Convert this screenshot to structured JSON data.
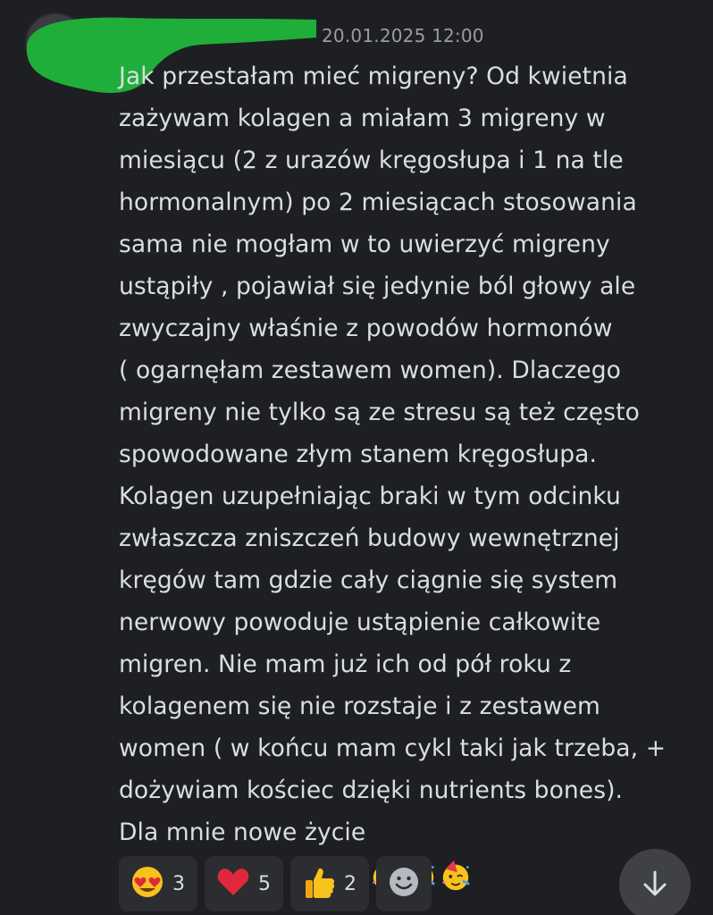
{
  "message": {
    "timestamp": "20.01.2025 12:00",
    "text": "Jak przestałam mieć migreny? Od kwietnia\nzażywam kolagen a miałam 3 migreny w\nmiesiącu (2 z urazów kręgosłupa i 1 na tle\nhormonalnym) po 2 miesiącach stosowania\nsama nie mogłam w to uwierzyć migreny\nustąpiły , pojawiał się jedynie ból głowy ale\nzwyczajny właśnie z powodów hormonów\n( ogarnęłam zestawem women). Dlaczego\nmigreny nie tylko są ze stresu są też często\nspowodowane złym stanem kręgosłupa.\nKolagen uzupełniając braki w tym odcinku\nzwłaszcza zniszczeń budowy wewnętrznej\nkręgów tam gdzie cały ciągnie się system\nnerwowy powoduje ustąpienie całkowite\nmigren. Nie mam już ich od pół roku z\nkolagenem się nie rozstaje i z zestawem\nwomen ( w końcu mam cykl taki jak trzeba, +\ndożywiam kościec dzięki nutrients bones).\nDla mnie nowe życie",
    "trailing_emojis": [
      "partying-face-icon",
      "partying-face-icon",
      "partying-face-icon"
    ]
  },
  "reactions": [
    {
      "icon": "heart-eyes-icon",
      "count": "3"
    },
    {
      "icon": "red-heart-icon",
      "count": "5"
    },
    {
      "icon": "thumbs-up-icon",
      "count": "2"
    }
  ],
  "colors": {
    "background": "#1e1f22",
    "text": "#dbdee1",
    "timestamp": "#9a9ca3",
    "reaction_bg": "#2b2d31",
    "redaction": "#1fae3a"
  }
}
